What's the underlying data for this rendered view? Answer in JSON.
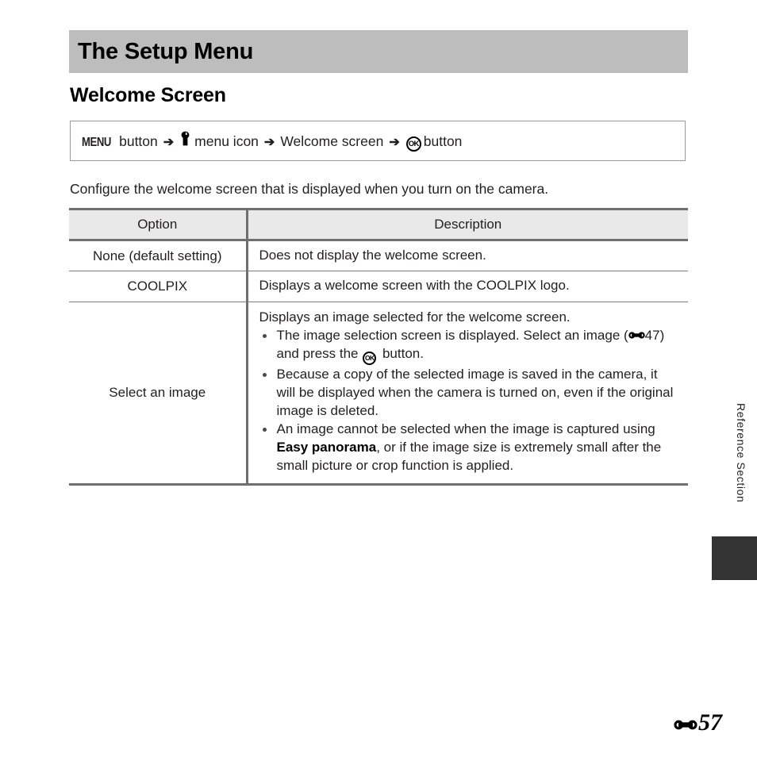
{
  "chapter": {
    "title": "The Setup Menu"
  },
  "section": {
    "heading": "Welcome Screen"
  },
  "nav_path": {
    "menu_button_glyph": "MENU",
    "menu_button_label": "button",
    "arrow": "➔",
    "setup_icon_name": "wrench-icon",
    "menu_icon_label": "menu icon",
    "step_welcome_screen": "Welcome screen",
    "ok_glyph": "OK",
    "ok_button_label": "button"
  },
  "intro": {
    "text": "Configure the welcome screen that is displayed when you turn on the camera."
  },
  "table": {
    "headers": [
      "Option",
      "Description"
    ],
    "rows": [
      {
        "option": "None (default setting)",
        "description_lead": "Does not display the welcome screen.",
        "bullets": []
      },
      {
        "option": "COOLPIX",
        "description_lead": "Displays a welcome screen with the COOLPIX logo.",
        "bullets": []
      },
      {
        "option": "Select an image",
        "description_lead": "Displays an image selected for the welcome screen.",
        "bullets": [
          {
            "part1": "The image selection screen is displayed. Select an image (",
            "ref_page": "47",
            "part2": ") and press the ",
            "ok_glyph": "OK",
            "part3": " button."
          },
          {
            "part1": "Because a copy of the selected image is saved in the camera, it will be displayed when the camera is turned on, even if the original image is deleted."
          },
          {
            "part1": "An image cannot be selected when the image is captured using ",
            "bold": "Easy panorama",
            "part2": ", or if the image size is extremely small after the small picture or crop function is applied."
          }
        ]
      }
    ]
  },
  "margin": {
    "side_label": "Reference Section"
  },
  "footer": {
    "page_prefix_icon": "reference-section-glyph",
    "page_number": "57"
  },
  "colors": {
    "banner": "#bdbdbd",
    "table_header_bg": "#e9e9e9",
    "rule_dark": "#6f6f6f",
    "side_tab": "#333333",
    "text": "#231f20"
  }
}
